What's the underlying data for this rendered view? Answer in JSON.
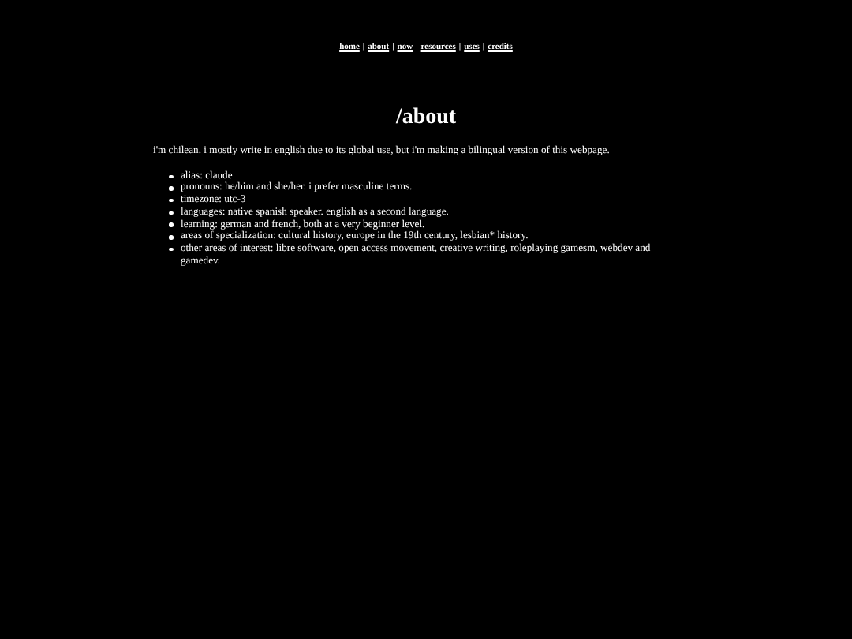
{
  "nav": {
    "links": [
      "home",
      "about",
      "now",
      "resources",
      "uses",
      "credits"
    ],
    "separator": "|"
  },
  "heading": "/about",
  "intro": "i'm chilean. i mostly write in english due to its global use, but i'm making a bilingual version of this webpage.",
  "facts": [
    "alias: claude",
    "pronouns: he/him and she/her. i prefer masculine terms.",
    "timezone: utc-3",
    "languages: native spanish speaker. english as a second language.",
    "learning: german and french, both at a very beginner level.",
    "areas of specialization: cultural history, europe in the 19th century, lesbian* history.",
    "other areas of interest: libre software, open access movement, creative writing, roleplaying gamesm, webdev and gamedev."
  ]
}
